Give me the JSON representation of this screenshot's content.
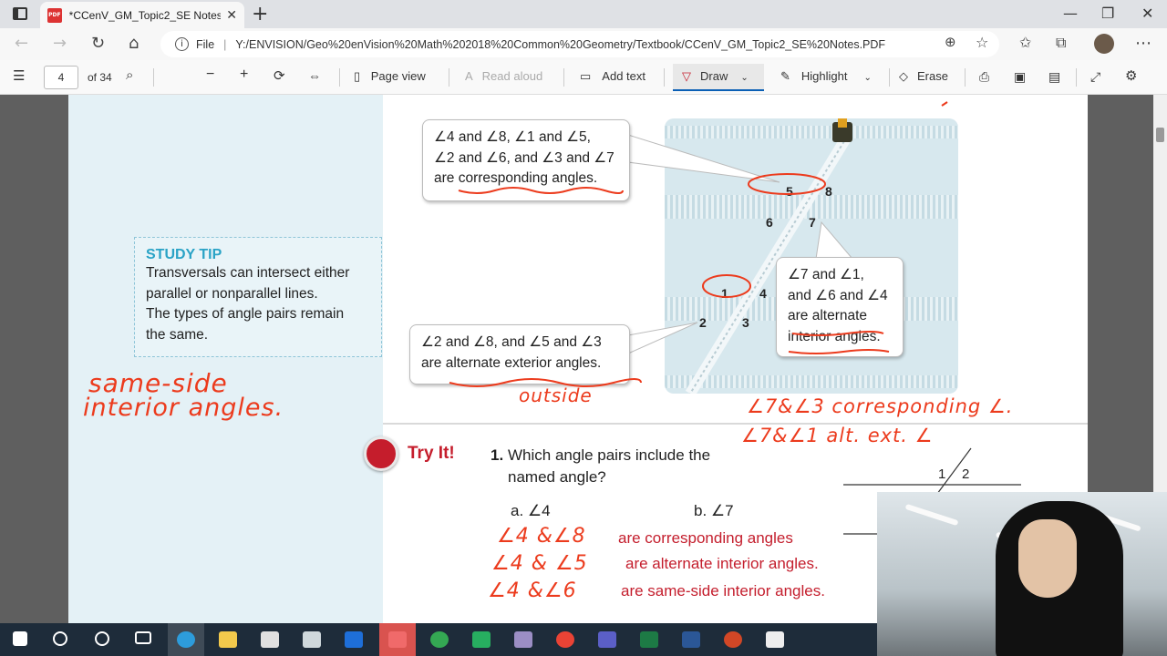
{
  "browser": {
    "tab_title": "*CCenV_GM_Topic2_SE Notes.PDF",
    "tab_close": "✕",
    "new_tab": "+",
    "url_label": "File",
    "url": "Y:/ENVISION/Geo%20enVision%20Math%202018%20Common%20Geometry/Textbook/CCenV_GM_Topic2_SE%20Notes.PDF"
  },
  "pdf_toolbar": {
    "page_number": "4",
    "page_total": "of 34",
    "page_view": "Page view",
    "read_aloud": "Read aloud",
    "add_text": "Add text",
    "draw": "Draw",
    "highlight": "Highlight",
    "erase": "Erase"
  },
  "document": {
    "callout_corresponding": [
      "∠4 and ∠8, ∠1 and ∠5,",
      "∠2 and ∠6, and ∠3 and ∠7",
      "are corresponding angles."
    ],
    "callout_alt_interior": [
      "∠7 and ∠1,",
      "and ∠6 and ∠4",
      "are alternate",
      "interior angles."
    ],
    "callout_alt_exterior": [
      "∠2 and ∠8, and ∠5 and ∠3",
      "are alternate exterior angles."
    ],
    "angle_labels": {
      "a5": "5",
      "a8": "8",
      "a6": "6",
      "a7": "7",
      "a1": "1",
      "a4": "4",
      "a2": "2",
      "a3": "3"
    },
    "study_tip": {
      "title": "STUDY TIP",
      "lines": [
        "Transversals can intersect either",
        "parallel or nonparallel lines.",
        "The types of angle pairs remain",
        "the same."
      ]
    },
    "try_it": {
      "label": "Try It!",
      "q_num": "1.",
      "question_line1": "Which angle pairs include the",
      "question_line2": "named angle?",
      "part_a": "a. ∠4",
      "part_b": "b. ∠7",
      "answers": [
        "are corresponding angles",
        "are alternate interior angles.",
        "are same-side interior angles."
      ],
      "fig_labels": {
        "l1": "1",
        "l2": "2"
      }
    }
  },
  "handwriting": {
    "same_side": "same-side",
    "interior_angles": "interior angles.",
    "outside": "outside",
    "corr_note": "∠7&∠3 corresponding ∠.",
    "alt_ext_note": "∠7&∠1 alt. ext. ∠",
    "ans1": "∠4 &∠8",
    "ans2": "∠4 & ∠5",
    "ans3": "∠4 &∠6"
  },
  "colors": {
    "accent": "#c51d2c",
    "ink": "#ec3b1d",
    "study_tip": "#2aa3c6",
    "draw_underline": "#0a5fb5"
  }
}
